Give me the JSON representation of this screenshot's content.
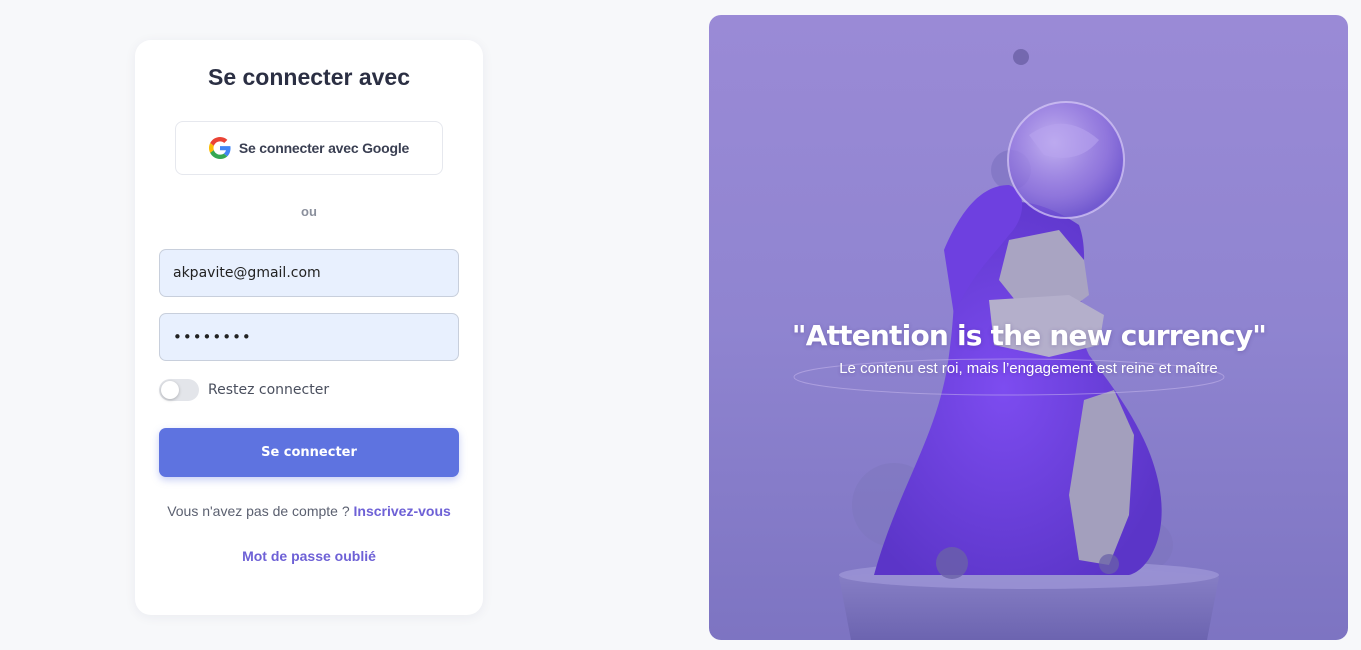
{
  "login": {
    "title": "Se connecter avec",
    "google_label": "Se connecter avec Google",
    "or_label": "ou",
    "email_value": "akpavite@gmail.com",
    "password_value": "12345678",
    "remember_label": "Restez connecter",
    "remember_on": false,
    "submit_label": "Se connecter",
    "no_account_text": "Vous n'avez pas de compte ?",
    "signup_link": "Inscrivez-vous",
    "forgot_link": "Mot de passe oublié"
  },
  "hero": {
    "quote": "\"Attention is the new currency\"",
    "subtitle": "Le contenu est roi, mais l’engagement est reine et maître"
  },
  "colors": {
    "page_bg": "#f7f8fa",
    "primary_button": "#5e73e0",
    "link": "#6e61d6",
    "input_bg": "#e8f0fe",
    "hero_tint": "#8d7fd4"
  },
  "icons": {
    "google": "google-g-logo"
  }
}
